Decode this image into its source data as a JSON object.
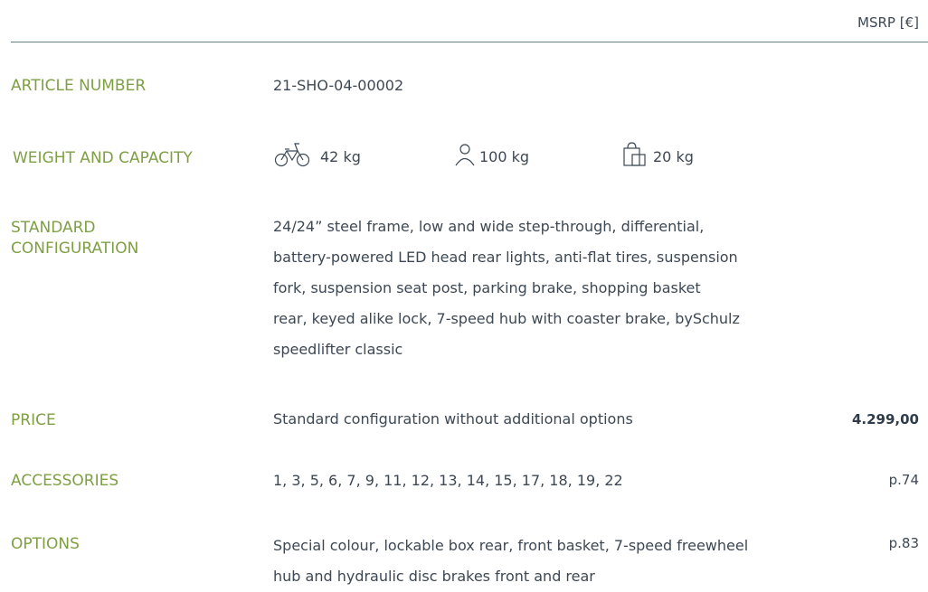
{
  "header": {
    "msrp_label": "MSRP [€]"
  },
  "article": {
    "label": "ARTICLE NUMBER",
    "value": "21-SHO-04-00002"
  },
  "weight": {
    "label": "WEIGHT AND CAPACITY",
    "items": [
      {
        "icon": "bicycle-icon",
        "value": "42 kg"
      },
      {
        "icon": "person-icon",
        "value": "100 kg"
      },
      {
        "icon": "bag-icon",
        "value": "20 kg"
      }
    ]
  },
  "standard": {
    "label_line1": "STANDARD",
    "label_line2": "CONFIGURATION",
    "lines": [
      "24/24” steel frame, low and wide step-through, differential,",
      "battery-powered LED head rear lights, anti-flat tires, suspension",
      "fork, suspension seat post, parking brake, shopping basket",
      "rear, keyed alike lock, 7-speed hub with coaster brake, bySchulz",
      "speedlifter classic"
    ]
  },
  "price": {
    "label": "PRICE",
    "description": "Standard configuration without additional options",
    "value": "4.299,00"
  },
  "accessories": {
    "label": "ACCESSORIES",
    "value": "1, 3, 5, 6, 7, 9, 11, 12, 13, 14, 15, 17, 18, 19, 22",
    "page": "p.74"
  },
  "options": {
    "label": "OPTIONS",
    "line1": "Special colour, lockable box rear, front basket, 7-speed freewheel",
    "line2": "hub and hydraulic disc brakes front and rear",
    "page": "p.83"
  },
  "colors": {
    "label_green": "#7ea043",
    "text": "#3d4854",
    "rule": "#6a7f8c"
  }
}
